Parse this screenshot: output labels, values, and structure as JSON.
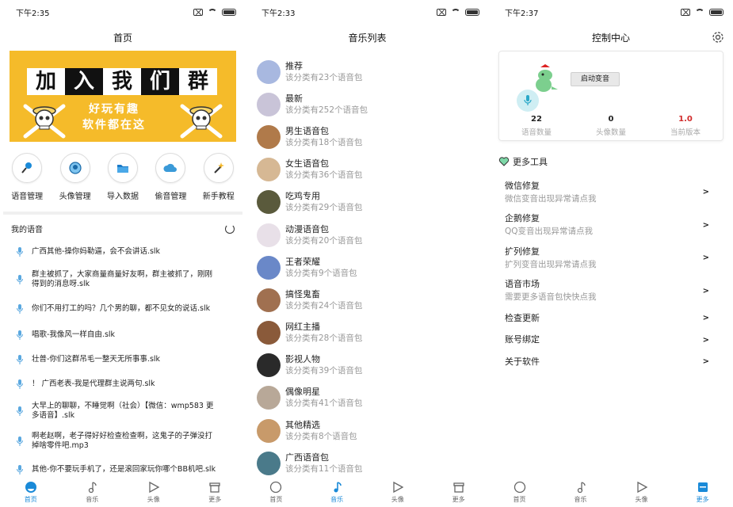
{
  "screens": [
    {
      "time": "下午2:35",
      "title": "首页",
      "banner": {
        "chars": [
          "加",
          "入",
          "我",
          "们",
          "群"
        ],
        "line1": "好玩有趣",
        "line2": "软件都在这"
      },
      "actions": [
        {
          "label": "语音管理",
          "icon": "mic-icon"
        },
        {
          "label": "头像管理",
          "icon": "avatar-icon"
        },
        {
          "label": "导入数据",
          "icon": "folder-icon"
        },
        {
          "label": "偷音管理",
          "icon": "cloud-icon"
        },
        {
          "label": "新手教程",
          "icon": "magic-wand-icon"
        }
      ],
      "section_title": "我的语音",
      "voices": [
        "广西其他-操你妈勒逼，会不会讲话.slk",
        "群主被抓了，大家商量商量好友啊，群主被抓了，刚刚得到的消息呀.slk",
        "你们不用打工的吗？几个男的聊，都不见女的说话.slk",
        "唱歌-我像风一样自由.slk",
        "壮普-你们这群吊毛一整天无所事事.slk",
        "！ 广西老表-我是代理群主说两句.slk",
        "大早上的聊聊，不睡觉啊（社会）【微信：wmp583 更多语音】.slk",
        "啊老赵啊，老子得好好检查检查啊，这鬼子的子弹没打掉啥零件吧.mp3",
        "其他-你不要玩手机了，还是滚回家玩你哪个BB机吧.slk"
      ]
    },
    {
      "time": "下午2:33",
      "title": "音乐列表",
      "items": [
        {
          "name": "推荐",
          "count": "该分类有23个语音包",
          "color": "#a8b8e0"
        },
        {
          "name": "最新",
          "count": "该分类有252个语音包",
          "color": "#c9c4d8"
        },
        {
          "name": "男生语音包",
          "count": "该分类有18个语音包",
          "color": "#b07a4a"
        },
        {
          "name": "女生语音包",
          "count": "该分类有36个语音包",
          "color": "#d6b894"
        },
        {
          "name": "吃鸡专用",
          "count": "该分类有29个语音包",
          "color": "#5a5a3c"
        },
        {
          "name": "动漫语音包",
          "count": "该分类有20个语音包",
          "color": "#e8e0e8"
        },
        {
          "name": "王者荣耀",
          "count": "该分类有9个语音包",
          "color": "#6a88c8"
        },
        {
          "name": "搞怪鬼畜",
          "count": "该分类有24个语音包",
          "color": "#a07050"
        },
        {
          "name": "网红主播",
          "count": "该分类有28个语音包",
          "color": "#8a5a3a"
        },
        {
          "name": "影视人物",
          "count": "该分类有39个语音包",
          "color": "#2a2a2a"
        },
        {
          "name": "偶像明星",
          "count": "该分类有41个语音包",
          "color": "#b8a898"
        },
        {
          "name": "其他精选",
          "count": "该分类有8个语音包",
          "color": "#c89a6a"
        },
        {
          "name": "广西语音包",
          "count": "该分类有11个语音包",
          "color": "#4a7a8a"
        }
      ]
    },
    {
      "time": "下午2:37",
      "title": "控制中心",
      "start_button": "启动变音",
      "stats": [
        {
          "value": "22",
          "label": "语音数量"
        },
        {
          "value": "0",
          "label": "头像数量"
        },
        {
          "value": "1.0",
          "label": "当前版本"
        }
      ],
      "tools_title": "更多工具",
      "tools": [
        {
          "title": "微信修复",
          "desc": "微信变音出现异常请点我"
        },
        {
          "title": "企鹅修复",
          "desc": "QQ变音出现异常请点我"
        },
        {
          "title": "扩列修复",
          "desc": "扩列变音出现异常请点我"
        },
        {
          "title": "语音市场",
          "desc": "需要更多语音包快快点我"
        },
        {
          "title": "检查更新",
          "desc": ""
        },
        {
          "title": "账号绑定",
          "desc": ""
        },
        {
          "title": "关于软件",
          "desc": ""
        }
      ],
      "chevron": ">"
    }
  ],
  "tabs": [
    "首页",
    "音乐",
    "头像",
    "更多"
  ],
  "colors": {
    "accent": "#1a8ad8",
    "banner": "#f5bb2a",
    "version_red": "#d12b2b",
    "tab_inactive": "#666666"
  }
}
